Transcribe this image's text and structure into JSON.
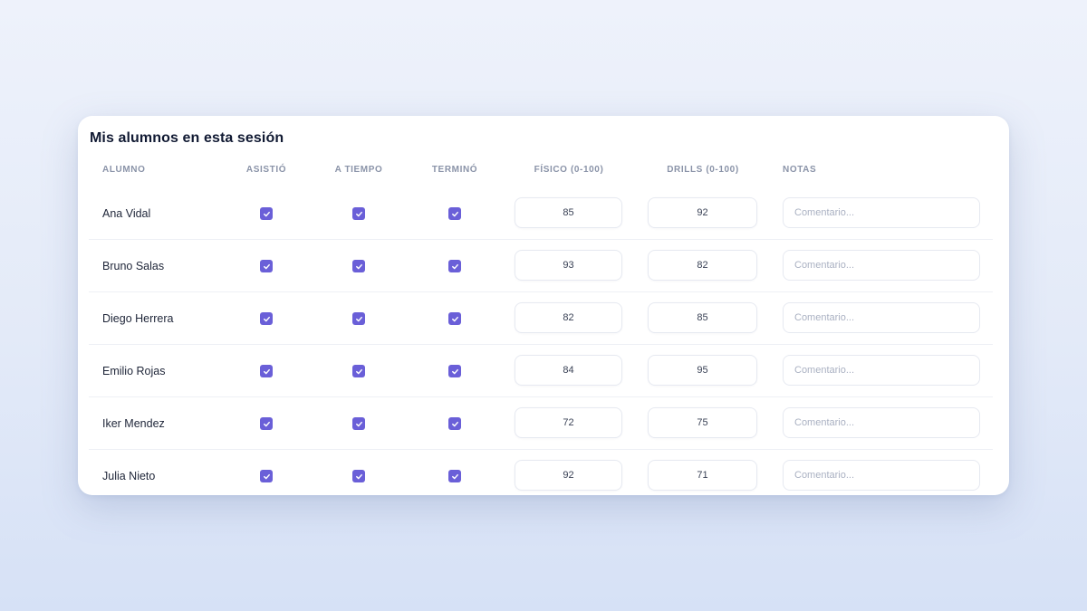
{
  "card": {
    "title": "Mis alumnos en esta sesión"
  },
  "table": {
    "headers": {
      "alumno": "ALUMNO",
      "asistio": "ASISTIÓ",
      "a_tiempo": "A TIEMPO",
      "termino": "TERMINÓ",
      "fisico": "FÍSICO (0-100)",
      "drills": "DRILLS (0-100)",
      "notas": "NOTAS"
    },
    "rows": [
      {
        "name": "Ana Vidal",
        "asistio": true,
        "a_tiempo": true,
        "termino": true,
        "fisico": "85",
        "drills": "92",
        "notas": ""
      },
      {
        "name": "Bruno Salas",
        "asistio": true,
        "a_tiempo": true,
        "termino": true,
        "fisico": "93",
        "drills": "82",
        "notas": ""
      },
      {
        "name": "Diego Herrera",
        "asistio": true,
        "a_tiempo": true,
        "termino": true,
        "fisico": "82",
        "drills": "85",
        "notas": ""
      },
      {
        "name": "Emilio Rojas",
        "asistio": true,
        "a_tiempo": true,
        "termino": true,
        "fisico": "84",
        "drills": "95",
        "notas": ""
      },
      {
        "name": "Iker Mendez",
        "asistio": true,
        "a_tiempo": true,
        "termino": true,
        "fisico": "72",
        "drills": "75",
        "notas": ""
      },
      {
        "name": "Julia Nieto",
        "asistio": true,
        "a_tiempo": true,
        "termino": true,
        "fisico": "92",
        "drills": "71",
        "notas": ""
      }
    ],
    "notes_placeholder": "Comentario..."
  },
  "colors": {
    "accent": "#6a5fd8",
    "title": "#111a33",
    "header_text": "#8a93a8"
  },
  "icons": {
    "checkbox": "check-icon"
  }
}
